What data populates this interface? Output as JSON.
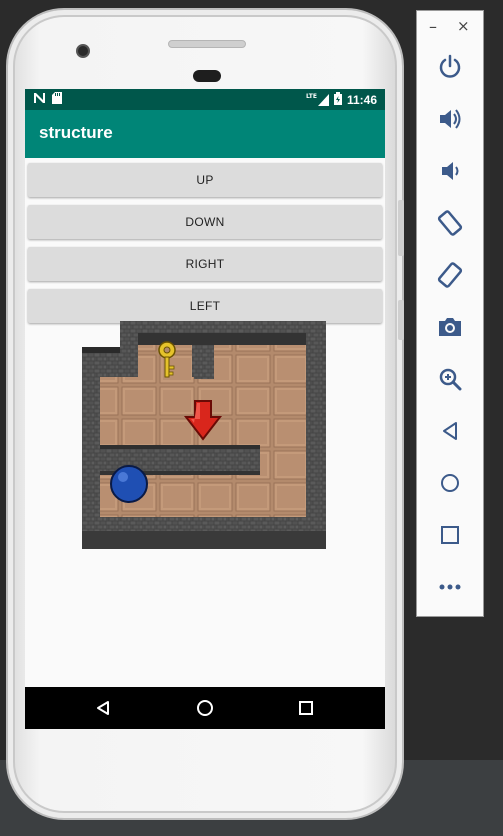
{
  "app": {
    "title": "structure"
  },
  "status_bar": {
    "time": "11:46",
    "network": "LTE",
    "icons": [
      "n-app-icon",
      "sd-card-icon",
      "signal-icon",
      "battery-icon"
    ]
  },
  "buttons": {
    "up": "UP",
    "down": "DOWN",
    "right": "RIGHT",
    "left": "LEFT"
  },
  "game": {
    "objects": [
      "key",
      "red-down-arrow",
      "blue-ball"
    ],
    "colors": {
      "wall": "#4a4a4a",
      "floor": "#b08a6e",
      "ball": "#1f4fb3",
      "arrow": "#d9261c",
      "key": "#e5c22b"
    }
  },
  "navigation": {
    "buttons": [
      "back-icon",
      "home-icon",
      "recents-icon"
    ]
  },
  "emulator_toolbar": {
    "minimize": "–",
    "close": "×",
    "items": [
      "power-icon",
      "volume-up-icon",
      "volume-down-icon",
      "rotate-left-icon",
      "rotate-right-icon",
      "screenshot-icon",
      "zoom-icon",
      "back-icon",
      "home-icon",
      "overview-icon",
      "more-icon"
    ]
  },
  "colors": {
    "status_bar": "#00574b",
    "app_bar": "#008577",
    "button": "#dcdcdc",
    "toolbar_icon": "#3c5a8a"
  }
}
